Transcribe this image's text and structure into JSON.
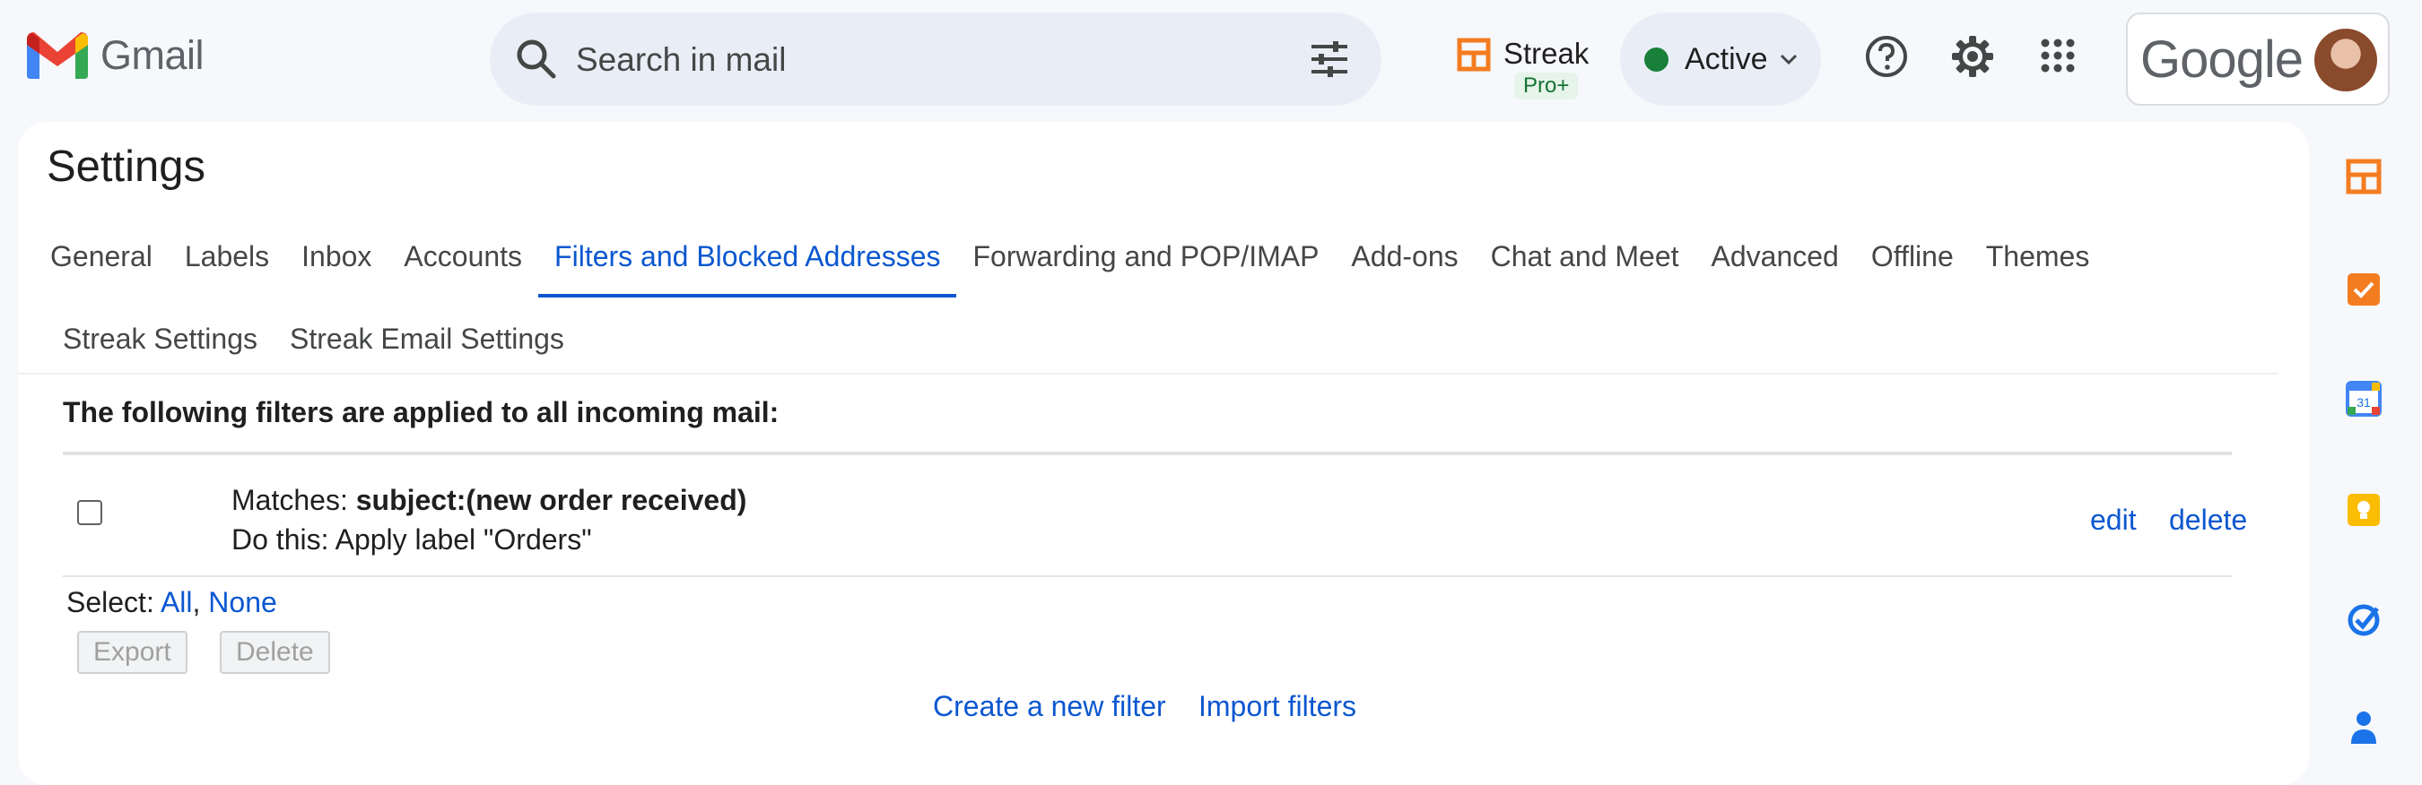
{
  "app": {
    "logo_text": "Gmail"
  },
  "search": {
    "placeholder": "Search in mail"
  },
  "streak": {
    "name": "Streak",
    "badge": "Pro+"
  },
  "status": {
    "label": "Active",
    "dot_color": "#188038"
  },
  "account": {
    "brand": "Google"
  },
  "settings": {
    "title": "Settings",
    "tabs": [
      "General",
      "Labels",
      "Inbox",
      "Accounts",
      "Filters and Blocked Addresses",
      "Forwarding and POP/IMAP",
      "Add-ons",
      "Chat and Meet",
      "Advanced",
      "Offline",
      "Themes"
    ],
    "active_tab": "Filters and Blocked Addresses",
    "tabs_row2": [
      "Streak Settings",
      "Streak Email Settings"
    ]
  },
  "filters": {
    "heading": "The following filters are applied to all incoming mail:",
    "items": [
      {
        "matches_prefix": "Matches: ",
        "matches_value": "subject:(new order received)",
        "action": "Do this: Apply label \"Orders\"",
        "edit": "edit",
        "delete": "delete"
      }
    ],
    "select_prefix": "Select: ",
    "select_all": "All",
    "select_sep": ", ",
    "select_none": "None",
    "export_button": "Export",
    "delete_button": "Delete",
    "create_link": "Create a new filter",
    "import_link": "Import filters"
  },
  "side_panel": {
    "icons": [
      "streak-icon",
      "tasks-icon",
      "calendar-icon",
      "keep-icon",
      "tasks-check-icon",
      "contacts-icon"
    ]
  },
  "colors": {
    "accent": "#0b57d0",
    "background": "#f6f8fc"
  }
}
